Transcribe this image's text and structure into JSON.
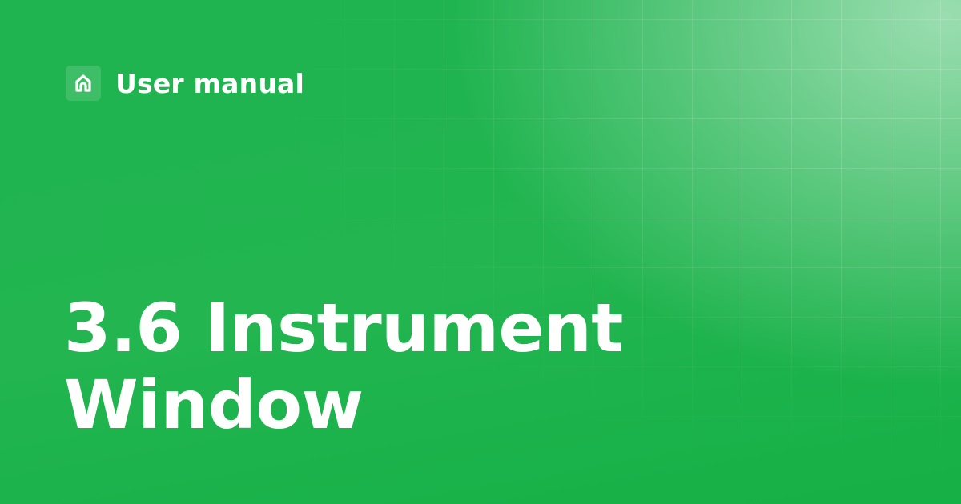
{
  "brand": {
    "icon": "home-logo-icon",
    "label": "User manual"
  },
  "title": {
    "line1": "3.6 Instrument",
    "line2": "Window"
  },
  "colors": {
    "background_primary": "#1fb450",
    "text": "#ffffff"
  }
}
